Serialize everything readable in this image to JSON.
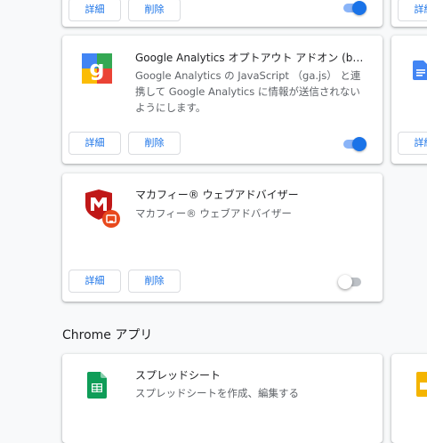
{
  "extensions": [
    {
      "id": "top",
      "details_label": "詳細",
      "remove_label": "削除",
      "enabled": true
    },
    {
      "id": "google-analytics-optout",
      "title": "Google Analytics オプトアウト アドオン (by G…",
      "description": "Google Analytics の JavaScript （ga.js） と連携して Google Analytics に情報が送信されないようにします。",
      "details_label": "詳細",
      "remove_label": "削除",
      "enabled": true,
      "icon": "google-analytics-logo-icon"
    },
    {
      "id": "mcafee-webadvisor",
      "title": "マカフィー® ウェブアドバイザー",
      "description": "マカフィー® ウェブアドバイザー",
      "details_label": "詳細",
      "remove_label": "削除",
      "enabled": false,
      "icon": "mcafee-shield-icon",
      "badge_icon": "policy-installed-badge-icon"
    }
  ],
  "right_column": {
    "top_details_label": "詳細",
    "mid_details_label": "詳細"
  },
  "apps_section": {
    "heading": "Chrome アプリ",
    "apps": [
      {
        "title": "スプレッドシート",
        "description": "スプレッドシートを作成、編集する",
        "icon": "google-sheets-icon"
      }
    ]
  },
  "colors": {
    "accent": "#1a73e8",
    "toggle_track_on": "#8ab4f8",
    "background": "#f8f9fa",
    "mcafee_red": "#c01818",
    "sheets_green": "#0f9d58"
  }
}
